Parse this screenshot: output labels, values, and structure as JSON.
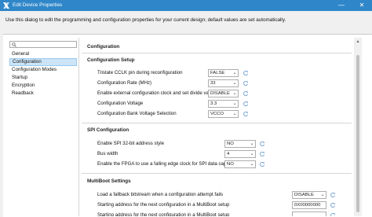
{
  "window": {
    "title": "Edit Device Properties",
    "app_icon": "xilinx-logo-icon",
    "controls": [
      "minimize",
      "close"
    ]
  },
  "intro_text": "Use this dialog to edit the programming and configuration properties for your current design; default values are set automatically.",
  "search": {
    "placeholder": "Q-",
    "value": ""
  },
  "nav": {
    "items": [
      {
        "label": "General",
        "selected": false
      },
      {
        "label": "Configuration",
        "selected": true
      },
      {
        "label": "Configuration Modes",
        "selected": false
      },
      {
        "label": "Startup",
        "selected": false
      },
      {
        "label": "Encryption",
        "selected": false
      },
      {
        "label": "Readback",
        "selected": false
      }
    ]
  },
  "page_title": "Configuration",
  "sections": [
    {
      "title": "Configuration Setup",
      "rows": [
        {
          "label": "Tristate CCLK pin during reconfiguration",
          "value": "FALSE",
          "type": "select"
        },
        {
          "label": "Configuration Rate (MHz)",
          "value": "33",
          "type": "select"
        },
        {
          "label": "Enable external configuration clock and set divide value",
          "value": "DISABLE",
          "type": "select"
        },
        {
          "label": "Configuration Voltage",
          "value": "3.3",
          "type": "select"
        },
        {
          "label": "Configuration Bank Voltage Selection",
          "value": "VCCO",
          "type": "select"
        }
      ]
    },
    {
      "title": "SPI Configuration",
      "rows": [
        {
          "label": "Enable SPI 32-bit address style",
          "value": "NO",
          "type": "select"
        },
        {
          "label": "Bus width",
          "value": "4",
          "type": "select"
        },
        {
          "label": "Enable the FPGA to use a falling edge clock for SPI data capture",
          "value": "NO",
          "type": "select"
        }
      ]
    },
    {
      "title": "MultiBoot Settings",
      "rows": [
        {
          "label": "Load a fallback bitstream when a configuration attempt fails",
          "value": "DISABLE",
          "type": "select"
        },
        {
          "label": "Starting address for the next configuration in a MultiBoot setup",
          "value": "0X00000000",
          "type": "text"
        },
        {
          "label": "Starting address for the next configuration in a MultiBoot setup",
          "value": "",
          "type": "text"
        }
      ]
    }
  ],
  "colors": {
    "titlebar": "#2f87c9",
    "selection": "#cce4f7",
    "reset_icon": "#6f9fd0"
  },
  "icons": {
    "reset": "reset-default-icon",
    "dropdown": "chevron-down-icon",
    "search": "search-icon"
  }
}
